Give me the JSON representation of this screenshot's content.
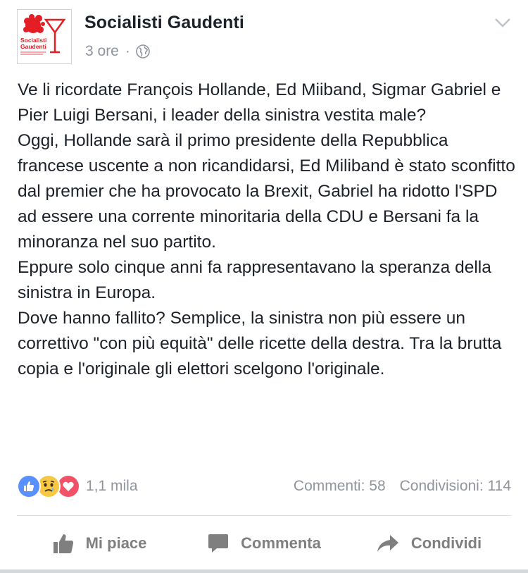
{
  "post": {
    "page_name": "Socialisti Gaudenti",
    "time": "3 ore",
    "separator": "·",
    "avatar": {
      "line1": "Socialisti",
      "line2": "Gaudenti",
      "brand_color": "#e31e24"
    },
    "paragraphs": [
      "Ve li ricordate François Hollande, Ed Miiband, Sigmar Gabriel e Pier Luigi Bersani, i leader della sinistra vestita male?",
      "Oggi, Hollande sarà il primo presidente della Repubblica francese uscente a non ricandidarsi, Ed Miliband è stato sconfitto dal premier che ha provocato la Brexit, Gabriel ha ridotto l'SPD ad essere una corrente minoritaria della CDU e Bersani fa la minoranza nel suo partito.",
      "Eppure solo cinque anni fa rappresentavano la speranza della sinistra in Europa.",
      "Dove hanno fallito? Semplice, la sinistra non più essere un correttivo \"con più equità\" delle ricette della destra. Tra la brutta copia e l'originale gli elettori scelgono l'originale."
    ]
  },
  "stats": {
    "reactions": [
      "like-icon",
      "sad-icon",
      "love-icon"
    ],
    "reaction_count": "1,1 mila",
    "comments": "Commenti: 58",
    "shares": "Condivisioni: 114"
  },
  "actions": {
    "like": "Mi piace",
    "comment": "Commenta",
    "share": "Condividi"
  },
  "colors": {
    "text": "#1d2129",
    "muted": "#90949c",
    "like_blue": "#5890ff",
    "love_red": "#f25268",
    "sad_yellow": "#f7c844"
  }
}
